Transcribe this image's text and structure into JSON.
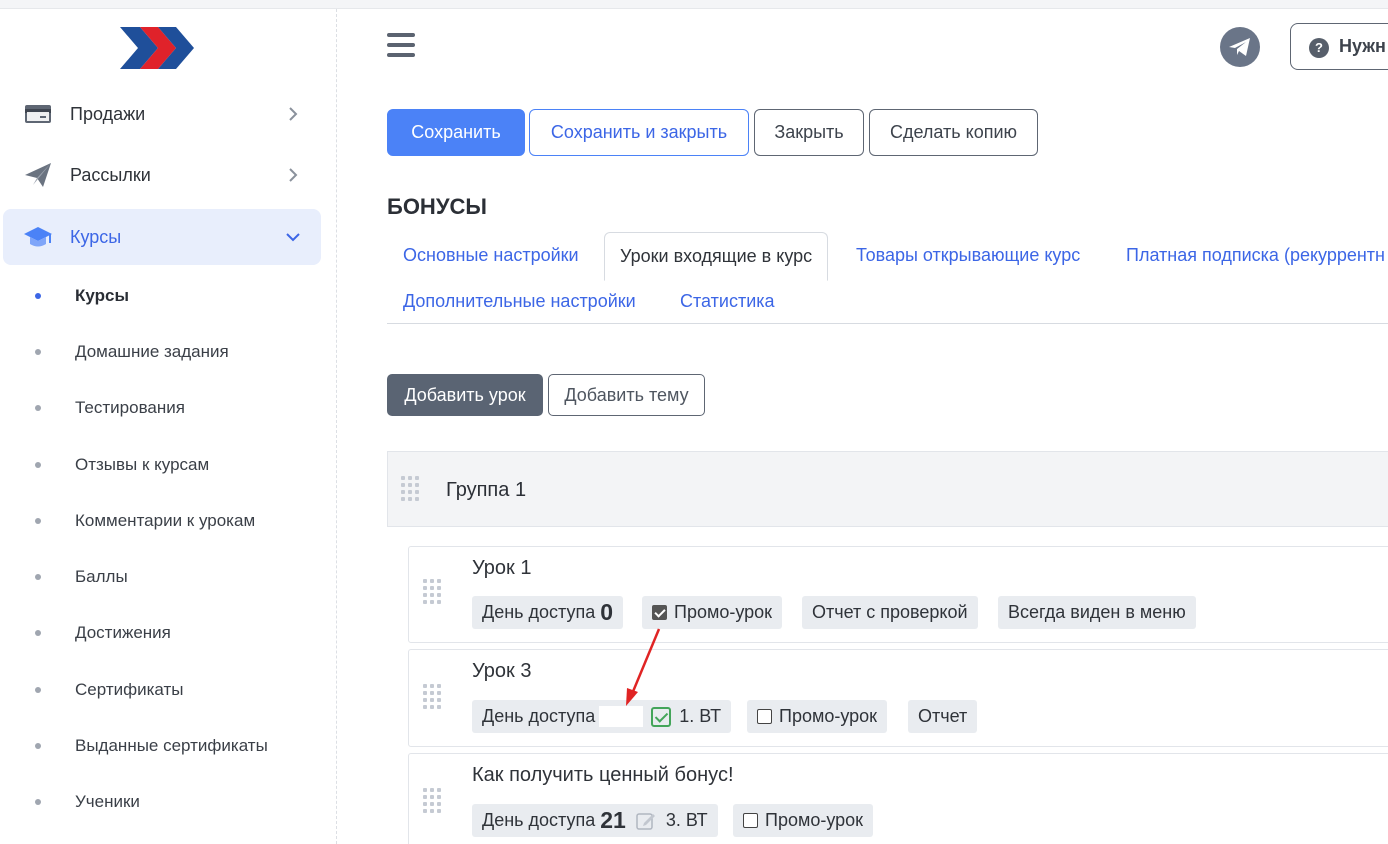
{
  "sidebar": {
    "items": [
      {
        "label": "Продажи",
        "icon": "card-icon"
      },
      {
        "label": "Рассылки",
        "icon": "paper-plane-icon"
      },
      {
        "label": "Курсы",
        "icon": "graduation-cap-icon",
        "active": true
      }
    ],
    "subitems": [
      {
        "label": "Курсы",
        "active": true
      },
      {
        "label": "Домашние задания"
      },
      {
        "label": "Тестирования"
      },
      {
        "label": "Отзывы к курсам"
      },
      {
        "label": "Комментарии к урокам"
      },
      {
        "label": "Баллы"
      },
      {
        "label": "Достижения"
      },
      {
        "label": "Сертификаты"
      },
      {
        "label": "Выданные сертификаты"
      },
      {
        "label": "Ученики"
      }
    ]
  },
  "header": {
    "help_label": "Нужн",
    "help_icon_text": "?"
  },
  "toolbar": {
    "save": "Сохранить",
    "save_close": "Сохранить и закрыть",
    "close": "Закрыть",
    "copy": "Сделать копию"
  },
  "section_title": "БОНУСЫ",
  "tabs": [
    {
      "label": "Основные настройки"
    },
    {
      "label": "Уроки входящие в курс",
      "active": true
    },
    {
      "label": "Товары открывающие курс"
    },
    {
      "label": "Платная подписка (рекуррентн"
    },
    {
      "label": "Дополнительные настройки"
    },
    {
      "label": "Статистика"
    }
  ],
  "actions": {
    "add_lesson": "Добавить урок",
    "add_topic": "Добавить тему"
  },
  "group": {
    "title": "Группа 1"
  },
  "lessons": [
    {
      "title": "Урок 1",
      "access_label": "День доступа",
      "access_day": "0",
      "promo_label": "Промо-урок",
      "promo_checked": true,
      "tags": [
        "Отчет с проверкой",
        "Всегда виден в меню"
      ]
    },
    {
      "title": "Урок 3",
      "access_label": "День доступа",
      "schedule": "1. ВТ",
      "promo_label": "Промо-урок",
      "promo_checked": false,
      "tags": [
        "Отчет"
      ]
    },
    {
      "title": "Как получить ценный бонус!",
      "access_label": "День доступа",
      "access_day": "21",
      "schedule": "3. ВТ",
      "promo_label": "Промо-урок",
      "promo_checked": false
    }
  ],
  "colors": {
    "accent": "#4b82f7",
    "active_nav_bg": "#e8eefc",
    "arrow": "#e02424"
  }
}
